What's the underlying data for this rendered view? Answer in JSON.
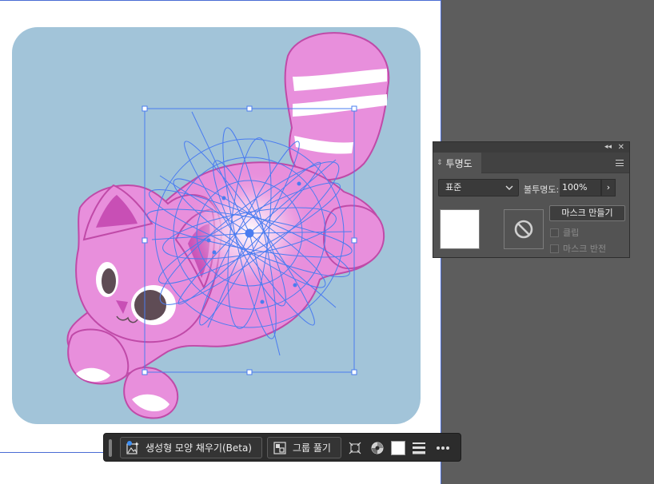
{
  "transparency_panel": {
    "collapse_glyph": "◂◂",
    "close_glyph": "✕",
    "tab_arrows": "⇕",
    "tab_label": "투명도",
    "menu_icon": "hamburger-icon",
    "blend_mode": "표준",
    "opacity_label": "불투명도:",
    "opacity_value": "100%",
    "opacity_stepper": "›",
    "make_mask_label": "마스크 만들기",
    "clip_label": "클립",
    "invert_mask_label": "마스크 반전",
    "clip_checked": false,
    "invert_checked": false
  },
  "taskbar": {
    "generative_fill_label": "생성형 모양 채우기(Beta)",
    "ungroup_label": "그룹 풀기",
    "icons": [
      "generative-fill-icon",
      "ungroup-icon",
      "transform-icon",
      "recolor-icon",
      "fill-swatch-icon",
      "stroke-lines-icon",
      "more-icon"
    ],
    "fill_swatch_color": "#ffffff"
  },
  "colors": {
    "artboard_bg": "#a2c4d9",
    "cat_body": "#e88fdc",
    "cat_outline": "#c04aa8",
    "selection": "#4a7cf0",
    "workspace": "#5d5d5d"
  }
}
